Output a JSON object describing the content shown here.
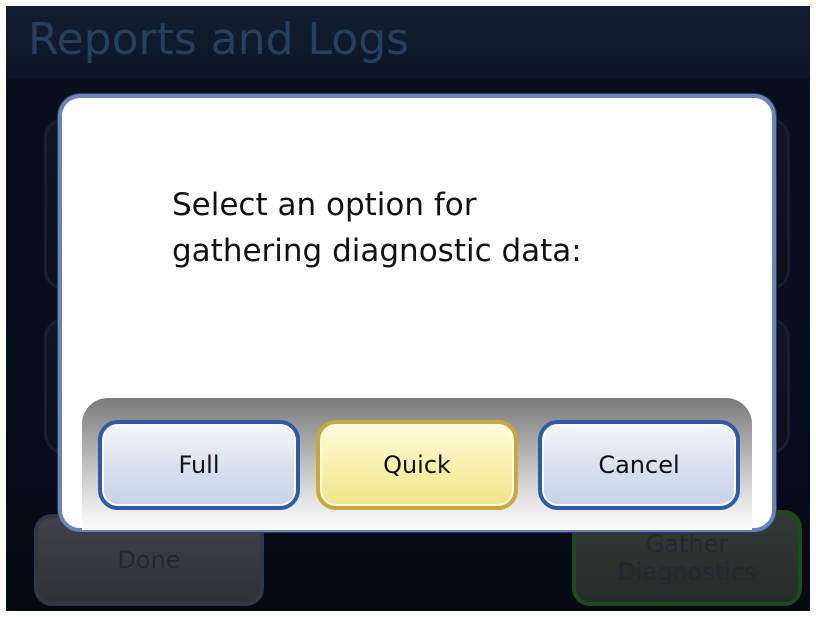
{
  "screen": {
    "title": "Reports and Logs"
  },
  "background_buttons": {
    "done_label": "Done",
    "gather_label_line1": "Gather",
    "gather_label_line2": "Diagnostics"
  },
  "dialog": {
    "message_line1": "Select an option for",
    "message_line2": "gathering diagnostic data:",
    "buttons": {
      "full_label": "Full",
      "quick_label": "Quick",
      "cancel_label": "Cancel"
    }
  },
  "colors": {
    "screen_background": "#0b1222",
    "dialog_border": "#6d82b7",
    "button_blue_border": "#2f5aa6",
    "button_yellow_border": "#c9a83a",
    "gather_border": "#1f5a22"
  }
}
